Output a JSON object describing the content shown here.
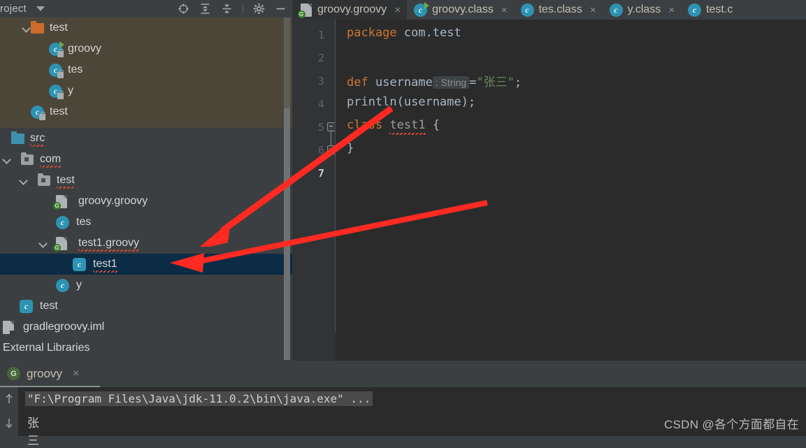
{
  "project_panel": {
    "title": "roject",
    "dropdown_icon": "chevron-down-icon",
    "toolbar": [
      {
        "name": "locate-icon",
        "label": "Select Opened File"
      },
      {
        "name": "expand-all-icon",
        "label": "Expand All"
      },
      {
        "name": "collapse-all-icon",
        "label": "Collapse All"
      },
      {
        "name": "gear-icon",
        "label": "Settings"
      },
      {
        "name": "minimize-icon",
        "label": "Hide"
      }
    ],
    "overlay_tree": [
      {
        "label": "test",
        "icon": "folder-orange-icon",
        "indent": 2,
        "expanded": true
      },
      {
        "label": "groovy",
        "icon": "class-run-icon",
        "indent": 3,
        "expanded": null
      },
      {
        "label": "tes",
        "icon": "class-icon",
        "indent": 3,
        "expanded": null
      },
      {
        "label": "y",
        "icon": "class-icon",
        "indent": 3,
        "expanded": null
      },
      {
        "label": "test",
        "icon": "class-icon",
        "indent": 2,
        "expanded": null
      }
    ],
    "main_tree": [
      {
        "label": "src",
        "icon": "folder-blue-icon",
        "indent": 0,
        "expanded": null,
        "error": true
      },
      {
        "label": "com",
        "icon": "package-icon",
        "indent": 1,
        "expanded": true,
        "error": true
      },
      {
        "label": "test",
        "icon": "package-icon",
        "indent": 2,
        "expanded": true,
        "error": true
      },
      {
        "label": "groovy.groovy",
        "icon": "groovy-file-icon",
        "indent": 3,
        "expanded": null,
        "error": false
      },
      {
        "label": "tes",
        "icon": "class-icon",
        "indent": 3,
        "expanded": null,
        "error": false
      },
      {
        "label": "test1.groovy",
        "icon": "groovy-file-icon",
        "indent": 3,
        "expanded": true,
        "error": true
      },
      {
        "label": "test1",
        "icon": "class-icon",
        "indent": 4,
        "expanded": null,
        "error": true,
        "selected": true
      },
      {
        "label": "y",
        "icon": "class-icon",
        "indent": 3,
        "expanded": null,
        "error": false
      },
      {
        "label": "test",
        "icon": "class-icon",
        "indent": 1,
        "expanded": null,
        "error": false
      },
      {
        "label": "gradlegroovy.iml",
        "icon": "iml-file-icon",
        "indent": 0,
        "expanded": null,
        "error": false
      },
      {
        "label": "External Libraries",
        "icon": "none",
        "indent": 0,
        "expanded": null,
        "error": false
      }
    ]
  },
  "editor": {
    "tabs": [
      {
        "label": "groovy.groovy",
        "icon": "groovy-file-icon",
        "active": true,
        "close": "×"
      },
      {
        "label": "groovy.class",
        "icon": "class-run-icon",
        "active": false,
        "close": "×"
      },
      {
        "label": "tes.class",
        "icon": "class-icon",
        "active": false,
        "close": "×"
      },
      {
        "label": "y.class",
        "icon": "class-icon",
        "active": false,
        "close": "×"
      },
      {
        "label": "test.c",
        "icon": "class-icon",
        "active": false,
        "close": ""
      }
    ],
    "line_numbers": [
      "1",
      "2",
      "3",
      "4",
      "5",
      "6",
      "7"
    ],
    "current_line": "7",
    "code_lines": [
      {
        "n": "1",
        "parts": [
          {
            "t": "package ",
            "c": "kw"
          },
          {
            "t": "com.test",
            "c": "id"
          }
        ]
      },
      {
        "n": "2",
        "parts": []
      },
      {
        "n": "3",
        "parts": [
          {
            "t": "def ",
            "c": "kw"
          },
          {
            "t": "username",
            "c": "id"
          },
          {
            "t": ": String",
            "c": "hint"
          },
          {
            "t": "=",
            "c": "id"
          },
          {
            "t": "\"张三\"",
            "c": "str"
          },
          {
            "t": ";",
            "c": "id"
          }
        ]
      },
      {
        "n": "4",
        "parts": [
          {
            "t": "println(username);",
            "c": "id"
          }
        ]
      },
      {
        "n": "5",
        "parts": [
          {
            "t": "class ",
            "c": "kw"
          },
          {
            "t": "test1",
            "c": "err"
          },
          {
            "t": " {",
            "c": "id"
          }
        ]
      },
      {
        "n": "6",
        "parts": [
          {
            "t": "}",
            "c": "id"
          }
        ]
      },
      {
        "n": "7",
        "parts": []
      }
    ]
  },
  "console": {
    "tab_label": "groovy",
    "tab_icon": "groovy-run-icon",
    "tab_close": "×",
    "output_command": "\"F:\\Program Files\\Java\\jdk-11.0.2\\bin\\java.exe\" ...",
    "output_result": "张三",
    "gutter_icons": [
      "arrow-up-icon",
      "arrow-down-icon"
    ]
  },
  "watermark": {
    "text": "CSDN @各个方面都自在"
  },
  "colors": {
    "selection_blue": "#254a87",
    "editor_bg": "#2b2b2b",
    "panel_bg": "#3c3f41",
    "overlay_bg": "#4c4639",
    "row_selected": "#0c2c45",
    "keyword_orange": "#cc7832",
    "string_green": "#6a8759",
    "annotation_red": "#ff2a22"
  },
  "annotations": {
    "arrow_1": "red-arrow-to-test1-groovy",
    "arrow_2": "red-arrow-to-test1-class"
  }
}
